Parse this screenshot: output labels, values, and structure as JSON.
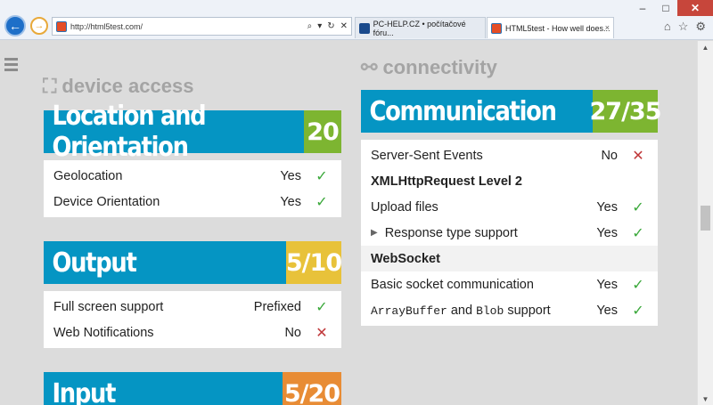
{
  "browser": {
    "url": "http://html5test.com/",
    "tabs": [
      {
        "label": "PC-HELP.CZ • počítačové fóru...",
        "close": "×"
      },
      {
        "label": "HTML5test - How well does...",
        "close": "×"
      }
    ],
    "window_buttons": {
      "minimize": "–",
      "maximize": "□",
      "close": "✕"
    }
  },
  "left": {
    "section_label": "device access",
    "cards": [
      {
        "title": "Location and Orientation",
        "score": "20",
        "rows": [
          {
            "label": "Geolocation",
            "value": "Yes",
            "mark": "✓"
          },
          {
            "label": "Device Orientation",
            "value": "Yes",
            "mark": "✓"
          }
        ]
      },
      {
        "title": "Output",
        "score": "5/10",
        "rows": [
          {
            "label": "Full screen support",
            "value": "Prefixed",
            "mark": "✓"
          },
          {
            "label": "Web Notifications",
            "value": "No",
            "mark": "✕"
          }
        ]
      },
      {
        "title": "Input",
        "score": "5/20"
      }
    ]
  },
  "right": {
    "section_label": "connectivity",
    "card": {
      "title": "Communication",
      "score": "27/35",
      "rows": [
        {
          "label": "Server-Sent Events",
          "value": "No",
          "mark": "✕"
        },
        {
          "group": "XMLHttpRequest Level 2"
        },
        {
          "label": "Upload files",
          "value": "Yes",
          "mark": "✓"
        },
        {
          "label": "Response type support",
          "value": "Yes",
          "mark": "✓"
        },
        {
          "group": "WebSocket"
        },
        {
          "label": "Basic socket communication",
          "value": "Yes",
          "mark": "✓"
        },
        {
          "label_parts": [
            "ArrayBuffer",
            " and ",
            "Blob",
            " support"
          ],
          "value": "Yes",
          "mark": "✓"
        }
      ]
    }
  },
  "colors": {
    "header_blue": "#0595c3",
    "score_green": "#7db531",
    "score_yellow": "#e8c23a",
    "score_orange": "#e88c35"
  }
}
